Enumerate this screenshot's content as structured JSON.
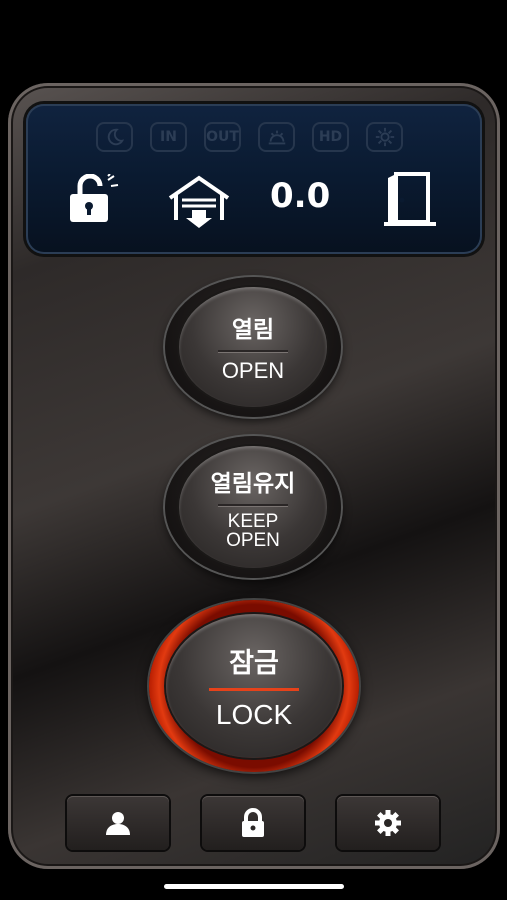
{
  "display": {
    "indicators": [
      {
        "icon": "night-icon",
        "label": ""
      },
      {
        "icon": "in-icon",
        "label": "IN"
      },
      {
        "icon": "out-icon",
        "label": "OUT"
      },
      {
        "icon": "sunrise-icon",
        "label": ""
      },
      {
        "icon": "hd-icon",
        "label": "HD"
      },
      {
        "icon": "gear-icon",
        "label": ""
      }
    ],
    "speed": "0.0",
    "lock_status_icon": "unlocked-padlock-icon",
    "garage_icon": "garage-icon",
    "door_icon": "door-open-icon",
    "inactive_color": "#2c3d55"
  },
  "buttons": {
    "open": {
      "kor": "열림",
      "eng": "OPEN"
    },
    "keep_open": {
      "kor": "열림유지",
      "eng_line1": "KEEP",
      "eng_line2": "OPEN"
    },
    "lock": {
      "kor": "잠금",
      "eng": "LOCK",
      "accent": "#e23a10"
    }
  },
  "bottom_bar": [
    {
      "icon": "user-icon"
    },
    {
      "icon": "padlock-icon"
    },
    {
      "icon": "settings-icon"
    }
  ]
}
